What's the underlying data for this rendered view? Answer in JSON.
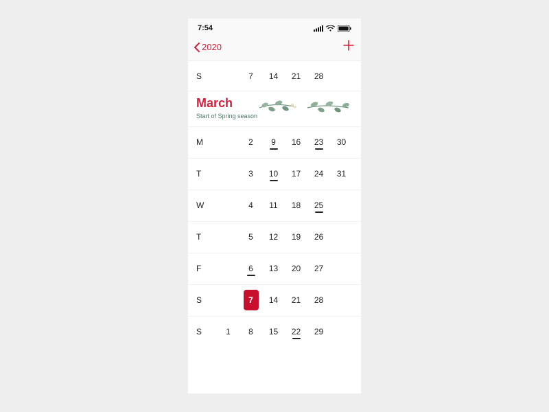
{
  "status": {
    "time": "7:54"
  },
  "nav": {
    "back_label": "2020"
  },
  "top_saturday": {
    "label": "S",
    "dates": [
      "",
      "7",
      "14",
      "21",
      "28",
      ""
    ]
  },
  "month": {
    "name": "March",
    "subtitle": "Start of Spring season"
  },
  "accent_color": "#d81e3a",
  "rows": [
    {
      "label": "M",
      "cells": [
        {
          "n": "",
          "dot": false,
          "today": false
        },
        {
          "n": "2",
          "dot": false,
          "today": false
        },
        {
          "n": "9",
          "dot": true,
          "today": false
        },
        {
          "n": "16",
          "dot": false,
          "today": false
        },
        {
          "n": "23",
          "dot": true,
          "today": false
        },
        {
          "n": "30",
          "dot": false,
          "today": false
        }
      ]
    },
    {
      "label": "T",
      "cells": [
        {
          "n": "",
          "dot": false,
          "today": false
        },
        {
          "n": "3",
          "dot": false,
          "today": false
        },
        {
          "n": "10",
          "dot": true,
          "today": false
        },
        {
          "n": "17",
          "dot": false,
          "today": false
        },
        {
          "n": "24",
          "dot": false,
          "today": false
        },
        {
          "n": "31",
          "dot": false,
          "today": false
        }
      ]
    },
    {
      "label": "W",
      "cells": [
        {
          "n": "",
          "dot": false,
          "today": false
        },
        {
          "n": "4",
          "dot": false,
          "today": false
        },
        {
          "n": "11",
          "dot": false,
          "today": false
        },
        {
          "n": "18",
          "dot": false,
          "today": false
        },
        {
          "n": "25",
          "dot": true,
          "today": false
        },
        {
          "n": "",
          "dot": false,
          "today": false
        }
      ]
    },
    {
      "label": "T",
      "cells": [
        {
          "n": "",
          "dot": false,
          "today": false
        },
        {
          "n": "5",
          "dot": false,
          "today": false
        },
        {
          "n": "12",
          "dot": false,
          "today": false
        },
        {
          "n": "19",
          "dot": false,
          "today": false
        },
        {
          "n": "26",
          "dot": false,
          "today": false
        },
        {
          "n": "",
          "dot": false,
          "today": false
        }
      ]
    },
    {
      "label": "F",
      "cells": [
        {
          "n": "",
          "dot": false,
          "today": false
        },
        {
          "n": "6",
          "dot": true,
          "today": false
        },
        {
          "n": "13",
          "dot": false,
          "today": false
        },
        {
          "n": "20",
          "dot": false,
          "today": false
        },
        {
          "n": "27",
          "dot": false,
          "today": false
        },
        {
          "n": "",
          "dot": false,
          "today": false
        }
      ]
    },
    {
      "label": "S",
      "cells": [
        {
          "n": "",
          "dot": false,
          "today": false
        },
        {
          "n": "7",
          "dot": false,
          "today": true
        },
        {
          "n": "14",
          "dot": false,
          "today": false
        },
        {
          "n": "21",
          "dot": false,
          "today": false
        },
        {
          "n": "28",
          "dot": false,
          "today": false
        },
        {
          "n": "",
          "dot": false,
          "today": false
        }
      ]
    },
    {
      "label": "S",
      "cells": [
        {
          "n": "1",
          "dot": false,
          "today": false
        },
        {
          "n": "8",
          "dot": false,
          "today": false
        },
        {
          "n": "15",
          "dot": false,
          "today": false
        },
        {
          "n": "22",
          "dot": true,
          "today": false
        },
        {
          "n": "29",
          "dot": false,
          "today": false
        },
        {
          "n": "",
          "dot": false,
          "today": false
        }
      ]
    }
  ]
}
